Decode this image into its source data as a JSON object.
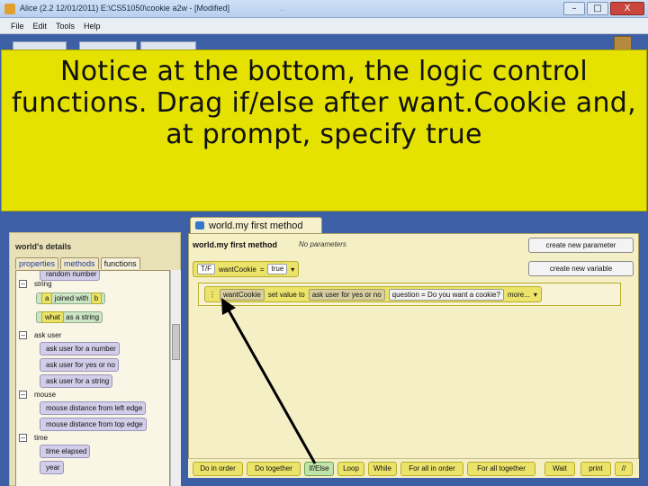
{
  "window": {
    "title": "Alice (2.2 12/01/2011) E:\\CS51050\\cookie a2w - [Modified]",
    "ghost_title": "..."
  },
  "window_buttons": {
    "minimize": "–",
    "maximize": "□",
    "close": "X"
  },
  "menu": [
    "File",
    "Edit",
    "Tools",
    "Help"
  ],
  "callout": {
    "text": "Notice at the bottom, the logic control functions.  Drag if/else after want.Cookie and, at prompt, specify true"
  },
  "details": {
    "header": "world's details",
    "tabs": [
      "properties",
      "methods",
      "functions"
    ],
    "active_tab": "functions",
    "top_cut": "random number",
    "categories": [
      {
        "name": "string",
        "toggle": "–"
      },
      {
        "name": "ask user",
        "toggle": "–"
      },
      {
        "name": "mouse",
        "toggle": "–"
      },
      {
        "name": "time",
        "toggle": "–"
      }
    ],
    "string_items": {
      "a": "a",
      "joined_with": "joined with",
      "b": "b",
      "what": "what",
      "as_a_string": "as a string"
    },
    "ask_user_items": [
      "ask user for a number",
      "ask user for yes or no",
      "ask user for a string"
    ],
    "mouse_items": [
      "mouse distance from left edge",
      "mouse distance from top edge"
    ],
    "time_items": [
      "time elapsed",
      "year"
    ]
  },
  "editor": {
    "tab_label": "world.my first method",
    "method_name": "world.my first method",
    "params": "No parameters",
    "create_param": "create new parameter",
    "create_var": "create new variable",
    "var": {
      "type_icon": "T/F",
      "name": "wantCookie",
      "eq": "=",
      "value": "true"
    },
    "statement": {
      "target": "wantCookie",
      "action": "set  value  to",
      "func": "ask user for yes or no",
      "question": "question = Do you want a cookie?",
      "more": "more..."
    }
  },
  "controls": [
    "Do in order",
    "Do together",
    "If/Else",
    "Loop",
    "While",
    "For all in order",
    "For all together",
    "Wait",
    "print",
    "//"
  ],
  "colors": {
    "callout": "#e5e100",
    "desktop": "#3c5fa6",
    "tile_yellow": "#ece46a",
    "tile_purple": "#d2cde8",
    "panel": "#f5efc6"
  }
}
